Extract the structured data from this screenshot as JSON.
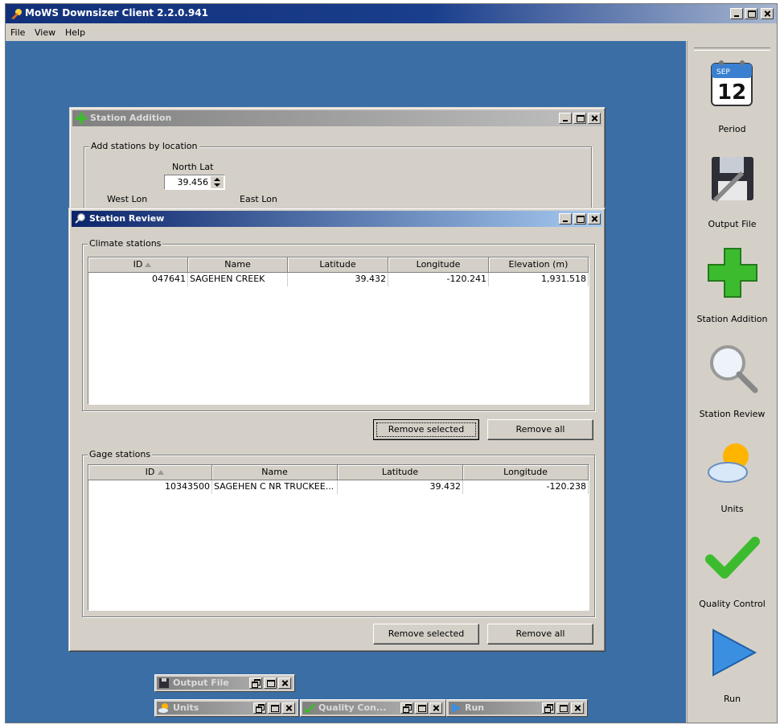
{
  "app": {
    "title": "MoWS Downsizer Client 2.2.0.941"
  },
  "menu": {
    "file": "File",
    "view": "View",
    "help": "Help"
  },
  "toolbar": [
    {
      "label": "Period",
      "icon": "calendar-icon",
      "calendar_month": "SEP",
      "calendar_day": "12"
    },
    {
      "label": "Output File",
      "icon": "floppy-disk-icon"
    },
    {
      "label": "Station Addition",
      "icon": "green-plus-icon"
    },
    {
      "label": "Station Review",
      "icon": "magnifier-icon"
    },
    {
      "label": "Units",
      "icon": "sun-cloud-icon"
    },
    {
      "label": "Quality Control",
      "icon": "checkmark-icon"
    },
    {
      "label": "Run",
      "icon": "play-arrow-icon"
    }
  ],
  "station_addition": {
    "title": "Station Addition",
    "group_label": "Add stations by location",
    "north_lat_label": "North Lat",
    "north_lat_value": "39.456",
    "west_lon_label": "West Lon",
    "east_lon_label": "East Lon"
  },
  "station_review": {
    "title": "Station Review",
    "climate": {
      "group_label": "Climate stations",
      "columns": [
        "ID",
        "Name",
        "Latitude",
        "Longitude",
        "Elevation (m)"
      ],
      "rows": [
        [
          "047641",
          "SAGEHEN CREEK",
          "39.432",
          "-120.241",
          "1,931.518"
        ]
      ],
      "remove_selected": "Remove selected",
      "remove_all": "Remove all"
    },
    "gage": {
      "group_label": "Gage stations",
      "columns": [
        "ID",
        "Name",
        "Latitude",
        "Longitude"
      ],
      "rows": [
        [
          "10343500",
          "SAGEHEN C NR TRUCKEE...",
          "39.432",
          "-120.238"
        ]
      ],
      "remove_selected": "Remove selected",
      "remove_all": "Remove all"
    }
  },
  "minimized_windows": [
    {
      "label": "Output File",
      "icon": "floppy-disk-icon"
    },
    {
      "label": "Units",
      "icon": "sun-cloud-icon"
    },
    {
      "label": "Quality Con...",
      "icon": "checkmark-icon"
    },
    {
      "label": "Run",
      "icon": "play-arrow-icon"
    }
  ]
}
